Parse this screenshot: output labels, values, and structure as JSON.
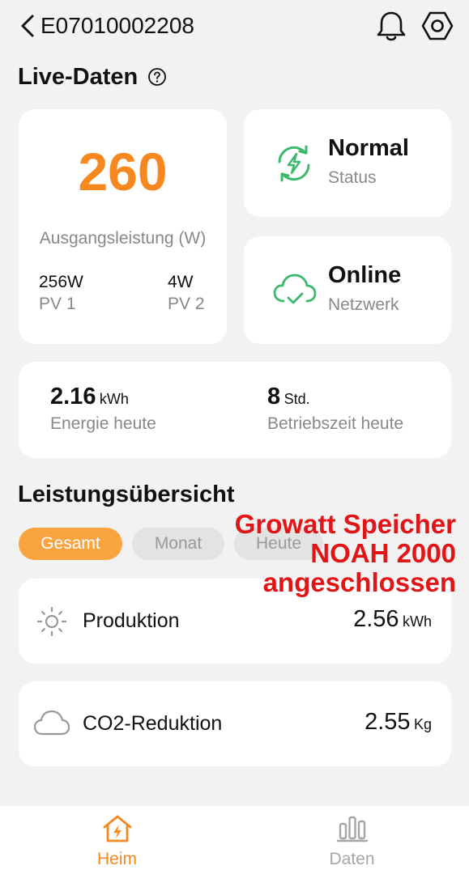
{
  "header": {
    "device_id": "E07010002208"
  },
  "live": {
    "title": "Live-Daten",
    "output_power": "260",
    "output_label": "Ausgangsleistung (W)",
    "pv1_value": "256W",
    "pv1_label": "PV 1",
    "pv2_value": "4W",
    "pv2_label": "PV 2",
    "status_value": "Normal",
    "status_label": "Status",
    "network_value": "Online",
    "network_label": "Netzwerk",
    "energy_today_value": "2.16",
    "energy_today_unit": "kWh",
    "energy_today_label": "Energie heute",
    "runtime_value": "8",
    "runtime_unit": "Std.",
    "runtime_label": "Betriebszeit heute"
  },
  "overview": {
    "title": "Leistungsübersicht",
    "tabs": [
      {
        "label": "Gesamt",
        "active": true
      },
      {
        "label": "Monat",
        "active": false
      },
      {
        "label": "Heute",
        "active": false
      }
    ],
    "production_label": "Produktion",
    "production_value": "2.56",
    "production_unit": "kWh",
    "co2_label": "CO2-Reduktion",
    "co2_value": "2.55",
    "co2_unit": "Kg"
  },
  "overlay": {
    "line1": "Growatt Speicher",
    "line2": "NOAH 2000",
    "line3": "angeschlossen"
  },
  "nav": {
    "home_label": "Heim",
    "data_label": "Daten"
  },
  "colors": {
    "accent": "#f7871f",
    "tab_active": "#f9a440",
    "status_green": "#3cb96b",
    "overlay_red": "#e11515",
    "nav_inactive": "#a6a6a6"
  },
  "icons": {
    "back": "chevron-left-icon",
    "bell": "bell-icon",
    "settings": "gear-icon",
    "help": "question-circle-icon",
    "status": "sync-bolt-icon",
    "network": "cloud-check-icon",
    "production": "sun-icon",
    "co2": "cloud-icon",
    "home": "home-bolt-icon",
    "data": "bar-chart-icon"
  }
}
